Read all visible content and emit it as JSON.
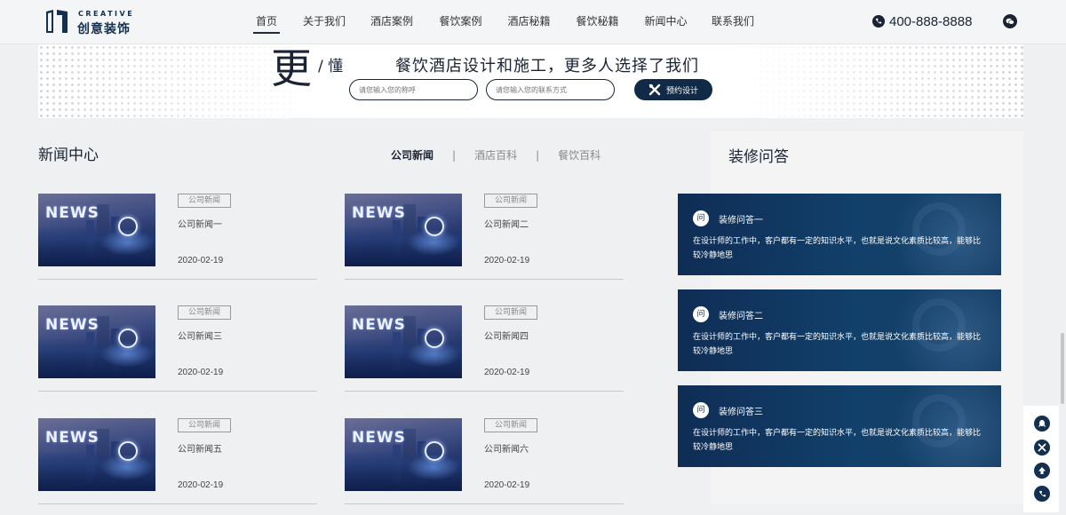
{
  "header": {
    "logo_en": "CREATIVE",
    "logo_cn": "创意装饰",
    "nav": [
      {
        "label": "首页",
        "active": true
      },
      {
        "label": "关于我们",
        "active": false
      },
      {
        "label": "酒店案例",
        "active": false
      },
      {
        "label": "餐饮案例",
        "active": false
      },
      {
        "label": "酒店秘籍",
        "active": false
      },
      {
        "label": "餐饮秘籍",
        "active": false
      },
      {
        "label": "新闻中心",
        "active": false
      },
      {
        "label": "联系我们",
        "active": false
      }
    ],
    "phone": "400-888-8888",
    "icons": {
      "phone": "phone-icon",
      "wechat": "wechat-icon"
    }
  },
  "banner": {
    "big_char": "更",
    "slash_char": "/ 懂",
    "slogan": "餐饮酒店设计和施工，更多人选择了我们",
    "name_placeholder": "请您输入您的称呼",
    "contact_placeholder": "请您输入您的联系方式",
    "button_label": "预约设计",
    "button_icon": "tools-icon"
  },
  "news": {
    "title": "新闻中心",
    "tabs": [
      {
        "label": "公司新闻",
        "active": true
      },
      {
        "label": "酒店百科",
        "active": false
      },
      {
        "label": "餐饮百科",
        "active": false
      }
    ],
    "tab_separator": "|",
    "thumb_text": "NEWS",
    "items": [
      {
        "badge": "公司新闻",
        "title": "公司新闻一",
        "date": "2020-02-19"
      },
      {
        "badge": "公司新闻",
        "title": "公司新闻二",
        "date": "2020-02-19"
      },
      {
        "badge": "公司新闻",
        "title": "公司新闻三",
        "date": "2020-02-19"
      },
      {
        "badge": "公司新闻",
        "title": "公司新闻四",
        "date": "2020-02-19"
      },
      {
        "badge": "公司新闻",
        "title": "公司新闻五",
        "date": "2020-02-19"
      },
      {
        "badge": "公司新闻",
        "title": "公司新闻六",
        "date": "2020-02-19"
      }
    ]
  },
  "faq": {
    "title": "装修问答",
    "badge": "问",
    "items": [
      {
        "question": "装修问答一",
        "answer": "在设计师的工作中，客户都有一定的知识水平，也就是说文化素质比较高，能够比较冷静地思"
      },
      {
        "question": "装修问答二",
        "answer": "在设计师的工作中，客户都有一定的知识水平，也就是说文化素质比较高，能够比较冷静地思"
      },
      {
        "question": "装修问答三",
        "answer": "在设计师的工作中，客户都有一定的知识水平，也就是说文化素质比较高，能够比较冷静地思"
      }
    ]
  },
  "float_bar": {
    "icons": [
      "qq-icon",
      "tools-icon",
      "back-to-top-icon",
      "phone-icon"
    ]
  },
  "colors": {
    "brand_navy": "#14304f",
    "button_navy": "#102a48",
    "faq_card": "#11406a",
    "page_bg": "#eef0f2"
  }
}
